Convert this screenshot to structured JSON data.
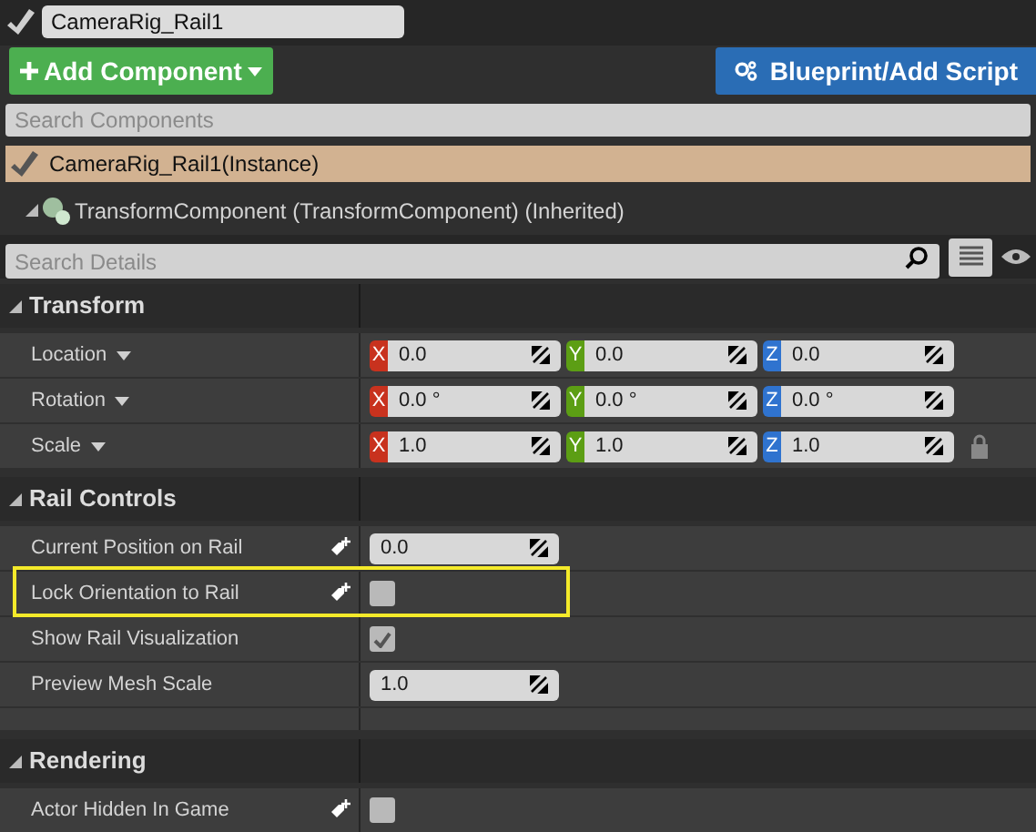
{
  "actor_name": "CameraRig_Rail1",
  "add_component_button": "Add Component",
  "blueprint_button": "Blueprint/Add Script",
  "component_search": {
    "placeholder": "Search Components"
  },
  "components": [
    {
      "label": "CameraRig_Rail1(Instance)",
      "selected": true,
      "children": [
        {
          "label": "TransformComponent (TransformComponent) (Inherited)",
          "selected": false
        }
      ]
    }
  ],
  "details_search": {
    "placeholder": "Search Details"
  },
  "sections": [
    {
      "title": "Transform",
      "expanded": true,
      "properties": [
        {
          "label": "Location",
          "kind": "vector",
          "has_menu": true,
          "axes": [
            {
              "letter": "X",
              "value": "0.0"
            },
            {
              "letter": "Y",
              "value": "0.0"
            },
            {
              "letter": "Z",
              "value": "0.0"
            }
          ],
          "locked": false
        },
        {
          "label": "Rotation",
          "kind": "vector",
          "has_menu": true,
          "axes": [
            {
              "letter": "X",
              "value": "0.0 °"
            },
            {
              "letter": "Y",
              "value": "0.0 °"
            },
            {
              "letter": "Z",
              "value": "0.0 °"
            }
          ],
          "locked": false
        },
        {
          "label": "Scale",
          "kind": "vector",
          "has_menu": true,
          "axes": [
            {
              "letter": "X",
              "value": "1.0"
            },
            {
              "letter": "Y",
              "value": "1.0"
            },
            {
              "letter": "Z",
              "value": "1.0"
            }
          ],
          "locked": true
        }
      ]
    },
    {
      "title": "Rail Controls",
      "expanded": true,
      "properties": [
        {
          "label": "Current Position on Rail",
          "kind": "number",
          "modified": true,
          "value": "0.0"
        },
        {
          "label": "Lock Orientation to Rail",
          "kind": "checkbox",
          "modified": true,
          "checked": false,
          "highlighted": true
        },
        {
          "label": "Show Rail Visualization",
          "kind": "checkbox",
          "modified": false,
          "checked": true,
          "highlighted": false
        },
        {
          "label": "Preview Mesh Scale",
          "kind": "number",
          "modified": false,
          "value": "1.0"
        }
      ]
    },
    {
      "title": "Rendering",
      "expanded": true,
      "properties": [
        {
          "label": "Actor Hidden In Game",
          "kind": "checkbox",
          "modified": true,
          "checked": false,
          "highlighted": false
        }
      ]
    }
  ]
}
